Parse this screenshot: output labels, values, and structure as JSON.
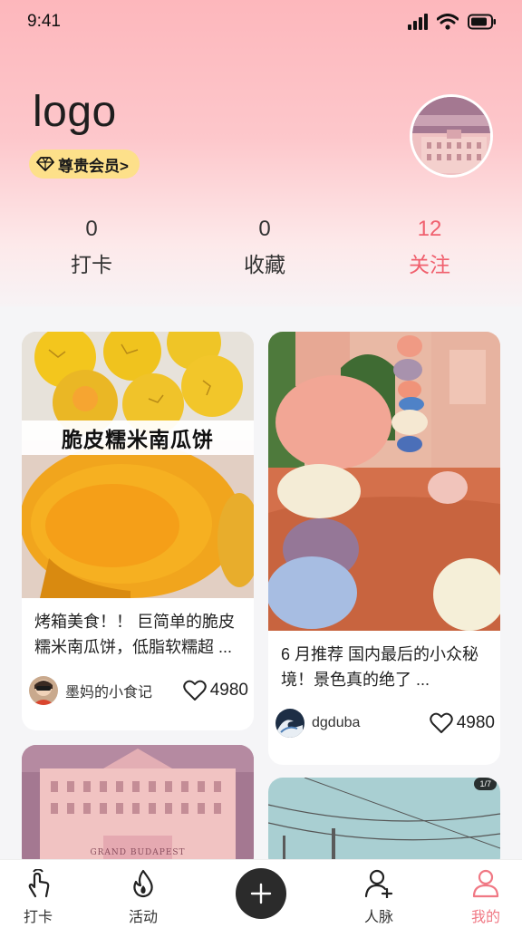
{
  "status_bar": {
    "time": "9:41"
  },
  "profile": {
    "logo": "logo",
    "vip_label": "尊贵会员>"
  },
  "stats": [
    {
      "value": "0",
      "label": "打卡"
    },
    {
      "value": "0",
      "label": "收藏"
    },
    {
      "value": "12",
      "label": "关注"
    }
  ],
  "cards": [
    {
      "image_caption": "脆皮糯米南瓜饼",
      "title": "烤箱美食！！ 巨简单的脆皮糯米南瓜饼，低脂软糯超 ...",
      "author": "墨妈的小食记",
      "likes": "4980"
    },
    {
      "title": "6 月推荐 国内最后的小众秘境！景色真的绝了 ...",
      "author": "dgduba",
      "likes": "4980"
    },
    {
      "image_caption": "GRAND BUDAPEST"
    },
    {
      "badge": "1/7"
    }
  ],
  "tab_bar": {
    "items": [
      {
        "label": "打卡",
        "icon": "tap-hand-icon"
      },
      {
        "label": "活动",
        "icon": "flame-icon"
      },
      {
        "label": "",
        "icon": "plus-icon"
      },
      {
        "label": "人脉",
        "icon": "add-user-icon"
      },
      {
        "label": "我的",
        "icon": "profile-icon"
      }
    ]
  },
  "colors": {
    "accent": "#f0606e",
    "vip_badge": "#fde08a",
    "header_top": "#fdb7bc"
  }
}
